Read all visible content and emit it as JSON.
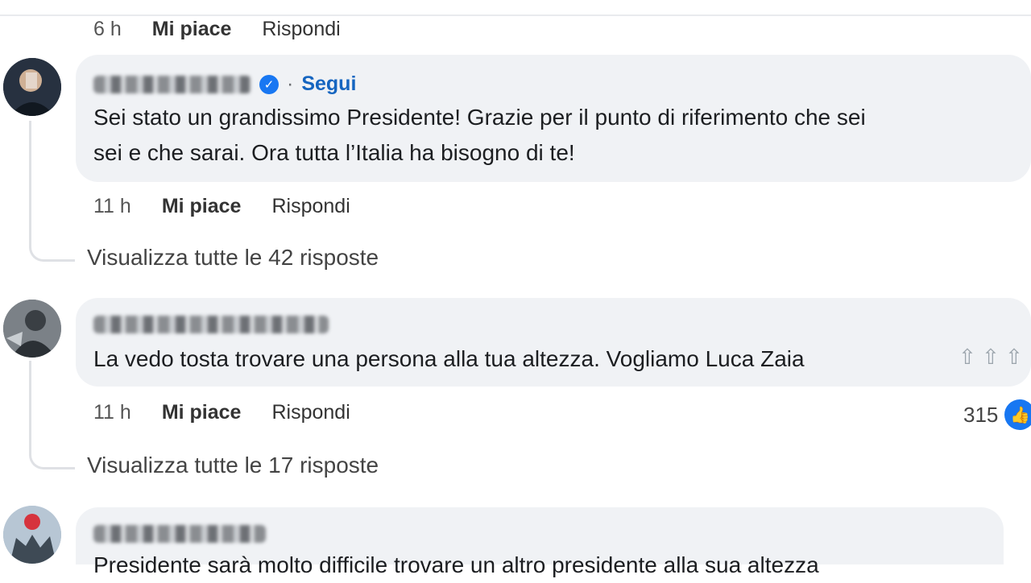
{
  "top_meta": {
    "time": "6 h",
    "like": "Mi piace",
    "reply": "Rispondi"
  },
  "comments": [
    {
      "follow": "Segui",
      "verified_icon": "✓",
      "text_lines": [
        "Sei stato un grandissimo Presidente! Grazie per il punto di riferimento che sei",
        "sei e che sarai. Ora tutta l’Italia ha bisogno di te!"
      ],
      "time": "11 h",
      "like": "Mi piace",
      "reply": "Rispondi",
      "view_replies": "Visualizza tutte le 42 risposte"
    },
    {
      "text_lines": [
        "La vedo tosta trovare una persona alla tua altezza. Vogliamo Luca Zaia"
      ],
      "emoji": "⇧ ⇧ ⇧",
      "time": "11 h",
      "like": "Mi piace",
      "reply": "Rispondi",
      "reaction_count": "315",
      "reaction_icon": "👍",
      "view_replies": "Visualizza tutte le 17 risposte"
    },
    {
      "text_lines": [
        "Presidente sarà molto difficile trovare un altro presidente alla sua altezza"
      ]
    }
  ]
}
